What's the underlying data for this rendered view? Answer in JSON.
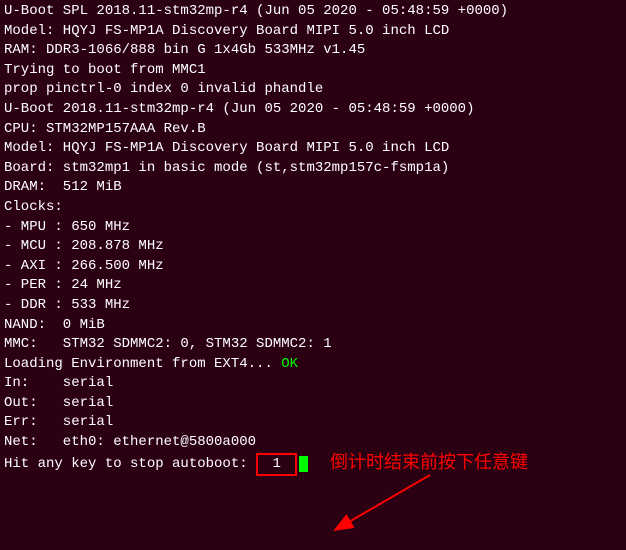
{
  "lines": {
    "l01": "U-Boot SPL 2018.11-stm32mp-r4 (Jun 05 2020 - 05:48:59 +0000)",
    "l02": "Model: HQYJ FS-MP1A Discovery Board MIPI 5.0 inch LCD",
    "l03": "RAM: DDR3-1066/888 bin G 1x4Gb 533MHz v1.45",
    "l04": "Trying to boot from MMC1",
    "l05": "prop pinctrl-0 index 0 invalid phandle",
    "l06": "",
    "l07": "",
    "l08": "U-Boot 2018.11-stm32mp-r4 (Jun 05 2020 - 05:48:59 +0000)",
    "l09": "",
    "l10": "CPU: STM32MP157AAA Rev.B",
    "l11": "Model: HQYJ FS-MP1A Discovery Board MIPI 5.0 inch LCD",
    "l12": "Board: stm32mp1 in basic mode (st,stm32mp157c-fsmp1a)",
    "l13": "DRAM:  512 MiB",
    "l14": "Clocks:",
    "l15": "- MPU : 650 MHz",
    "l16": "- MCU : 208.878 MHz",
    "l17": "- AXI : 266.500 MHz",
    "l18": "- PER : 24 MHz",
    "l19": "- DDR : 533 MHz",
    "l20": "NAND:  0 MiB",
    "l21": "MMC:   STM32 SDMMC2: 0, STM32 SDMMC2: 1",
    "l22a": "Loading Environment from EXT4... ",
    "l22b": "OK",
    "l23": "In:    serial",
    "l24": "Out:   serial",
    "l25": "Err:   serial",
    "l26": "Net:   eth0: ethernet@5800a000",
    "l27a": "Hit any key to stop autoboot: ",
    "l27b": " 1 "
  },
  "annotation": {
    "text": "倒计时结束前按下任意键"
  }
}
